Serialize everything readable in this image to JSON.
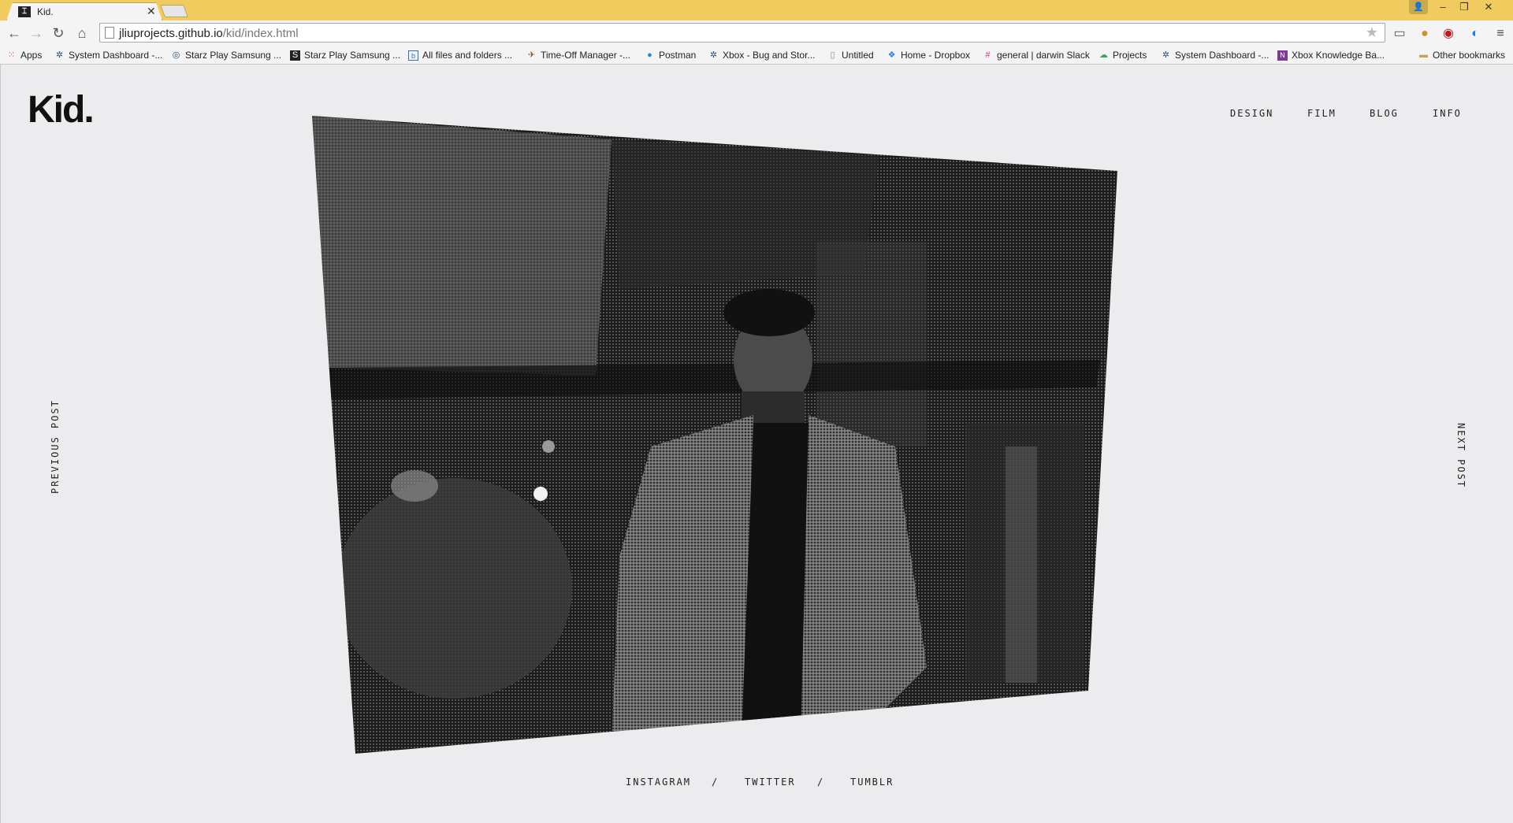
{
  "browser": {
    "tab_title": "Kid.",
    "tab_favicon": "kid-favicon",
    "url_host": "jliuprojects.github.io",
    "url_path": "/kid/index.html",
    "bookmarks": [
      {
        "label": "Apps",
        "icon": "apps-icon"
      },
      {
        "label": "System Dashboard -...",
        "icon": "dashboard-icon"
      },
      {
        "label": "Starz Play Samsung ...",
        "icon": "starz-icon"
      },
      {
        "label": "Starz Play Samsung ...",
        "icon": "starz-icon"
      },
      {
        "label": "All files and folders ...",
        "icon": "box-icon"
      },
      {
        "label": "Time-Off Manager -...",
        "icon": "timeoff-icon"
      },
      {
        "label": "Postman",
        "icon": "postman-icon"
      },
      {
        "label": "Xbox - Bug and Stor...",
        "icon": "dashboard-icon"
      },
      {
        "label": "Untitled",
        "icon": "page-icon"
      },
      {
        "label": "Home - Dropbox",
        "icon": "dropbox-icon"
      },
      {
        "label": "general | darwin Slack",
        "icon": "slack-icon"
      },
      {
        "label": "Projects",
        "icon": "projects-icon"
      },
      {
        "label": "System Dashboard -...",
        "icon": "dashboard-icon"
      },
      {
        "label": "Xbox Knowledge Ba...",
        "icon": "onenote-icon"
      }
    ],
    "other_bookmarks": "Other bookmarks"
  },
  "site": {
    "logo": "Kid.",
    "nav": [
      "DESIGN",
      "FILM",
      "BLOG",
      "INFO"
    ],
    "previous_post": "PREVIOUS POST",
    "next_post": "NEXT POST",
    "social": [
      "INSTAGRAM",
      "TWITTER",
      "TUMBLR"
    ],
    "separator": "/"
  },
  "colors": {
    "titlebar": "#f1cb5e",
    "page_bg": "#ecebee",
    "text": "#222222"
  }
}
